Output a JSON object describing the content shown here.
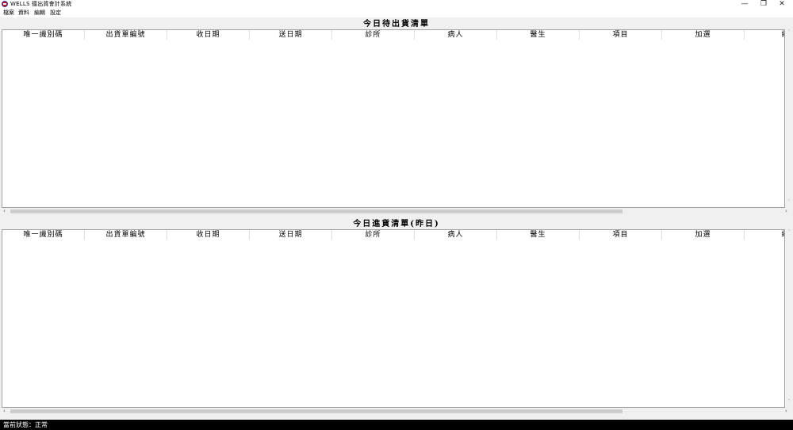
{
  "window": {
    "title": "WELLS 擂出貨會計系統",
    "minimize": "—",
    "restore": "❐",
    "close": "✕"
  },
  "menu": [
    "檔案",
    "資料",
    "編輯",
    "設定"
  ],
  "sections": [
    {
      "title": "今日待出貨清單",
      "columns": [
        "唯一識別碼",
        "出貨單編號",
        "收日期",
        "送日期",
        "診所",
        "病人",
        "醫生",
        "項目",
        "加選",
        "總"
      ]
    },
    {
      "title": "今日進貨清單(昨日)",
      "columns": [
        "唯一識別碼",
        "出貨單編號",
        "收日期",
        "送日期",
        "診所",
        "病人",
        "醫生",
        "項目",
        "加選",
        "總"
      ]
    }
  ],
  "status": {
    "text": "當前狀態：正常"
  },
  "icons": {
    "app": "app-logo-icon",
    "scroll_left": "‹",
    "scroll_right": "›",
    "scroll_up": "˄",
    "scroll_down": "˅"
  }
}
